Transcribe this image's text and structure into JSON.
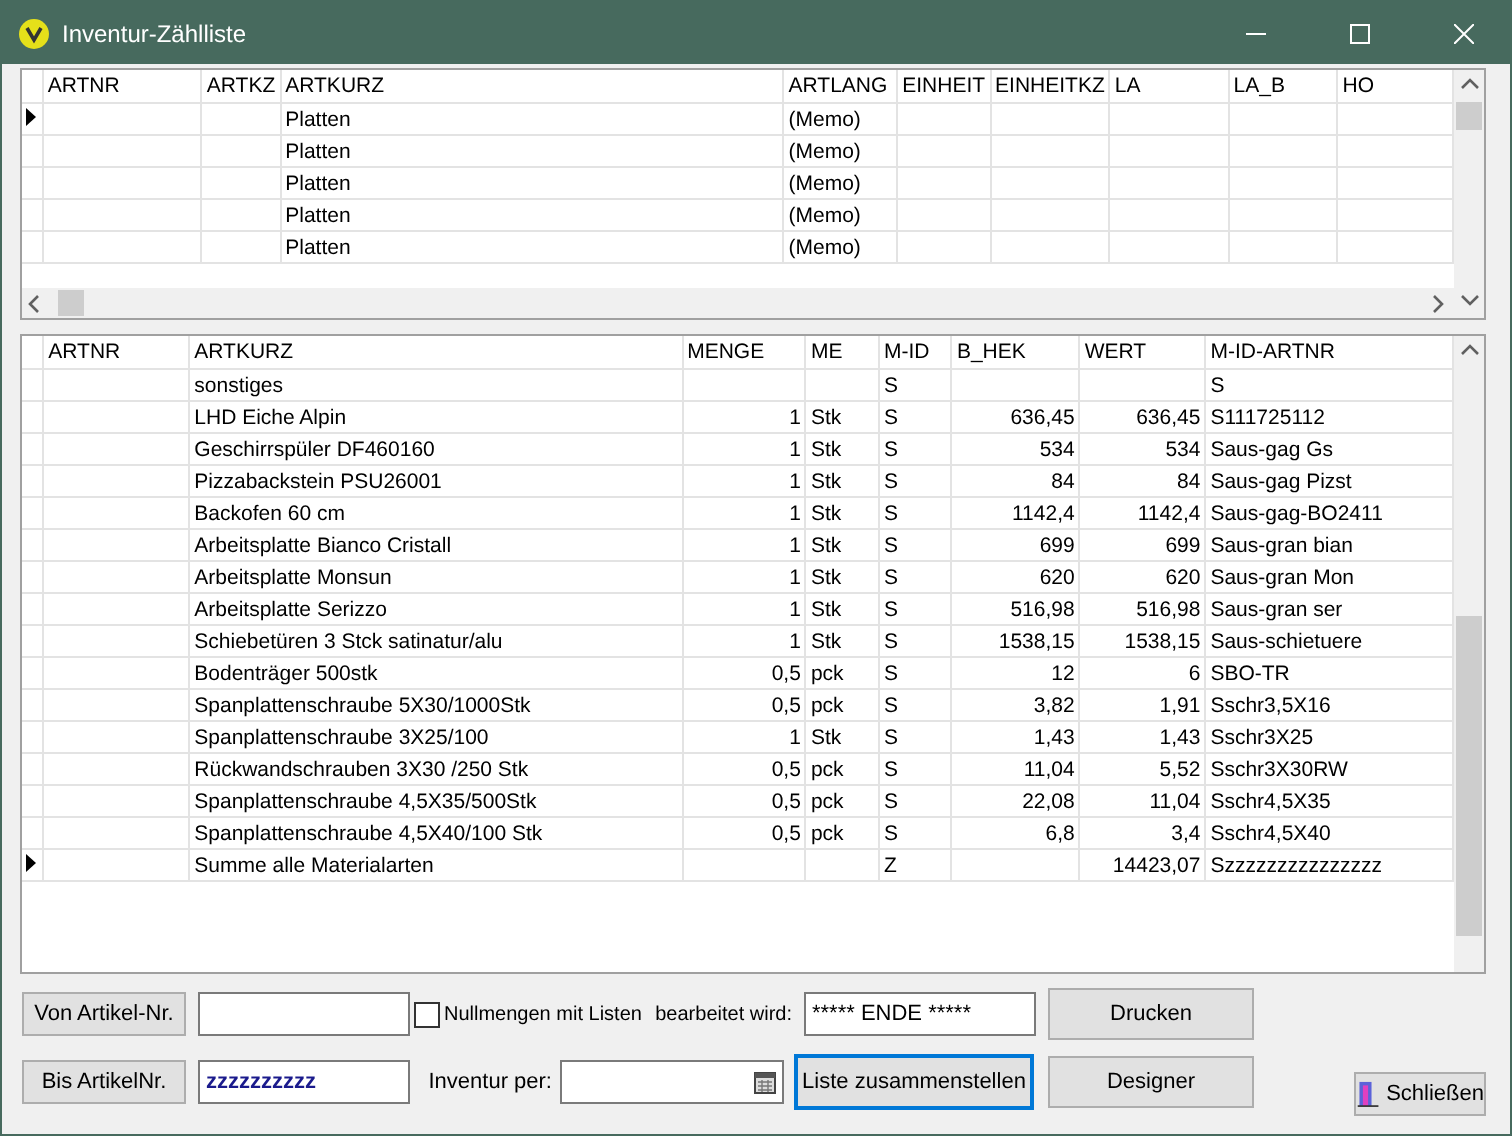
{
  "window": {
    "title": "Inventur-Zählliste"
  },
  "upper_grid": {
    "columns": [
      "ARTNR",
      "ARTKZ",
      "ARTKURZ",
      "ARTLANG",
      "EINHEIT",
      "EINHEITKZ",
      "LA",
      "LA_B",
      "HO"
    ],
    "rows": [
      {
        "current": true,
        "cells": [
          "",
          "",
          "Platten",
          "(Memo)",
          "",
          "",
          "",
          "",
          ""
        ]
      },
      {
        "current": false,
        "cells": [
          "",
          "",
          "Platten",
          "(Memo)",
          "",
          "",
          "",
          "",
          ""
        ]
      },
      {
        "current": false,
        "cells": [
          "",
          "",
          "Platten",
          "(Memo)",
          "",
          "",
          "",
          "",
          ""
        ]
      },
      {
        "current": false,
        "cells": [
          "",
          "",
          "Platten",
          "(Memo)",
          "",
          "",
          "",
          "",
          ""
        ]
      },
      {
        "current": false,
        "cells": [
          "",
          "",
          "Platten",
          "(Memo)",
          "",
          "",
          "",
          "",
          ""
        ]
      }
    ]
  },
  "lower_grid": {
    "columns": [
      "ARTNR",
      "ARTKURZ",
      "MENGE",
      "ME",
      "M-ID",
      "B_HEK",
      "WERT",
      "M-ID-ARTNR"
    ],
    "rows": [
      {
        "current": false,
        "cells": [
          "",
          "sonstiges",
          "",
          "",
          "S",
          "",
          "",
          "S"
        ]
      },
      {
        "current": false,
        "cells": [
          "",
          "LHD Eiche Alpin",
          "1",
          "Stk",
          "S",
          "636,45",
          "636,45",
          "S111725112"
        ]
      },
      {
        "current": false,
        "cells": [
          "",
          "Geschirrspüler DF460160",
          "1",
          "Stk",
          "S",
          "534",
          "534",
          "Saus-gag Gs"
        ]
      },
      {
        "current": false,
        "cells": [
          "",
          "Pizzabackstein PSU26001",
          "1",
          "Stk",
          "S",
          "84",
          "84",
          "Saus-gag Pizst"
        ]
      },
      {
        "current": false,
        "cells": [
          "",
          "Backofen 60 cm",
          "1",
          "Stk",
          "S",
          "1142,4",
          "1142,4",
          "Saus-gag-BO2411"
        ]
      },
      {
        "current": false,
        "cells": [
          "",
          "Arbeitsplatte Bianco Cristall",
          "1",
          "Stk",
          "S",
          "699",
          "699",
          "Saus-gran bian"
        ]
      },
      {
        "current": false,
        "cells": [
          "",
          "Arbeitsplatte Monsun",
          "1",
          "Stk",
          "S",
          "620",
          "620",
          "Saus-gran Mon"
        ]
      },
      {
        "current": false,
        "cells": [
          "",
          "Arbeitsplatte Serizzo",
          "1",
          "Stk",
          "S",
          "516,98",
          "516,98",
          "Saus-gran ser"
        ]
      },
      {
        "current": false,
        "cells": [
          "",
          "Schiebetüren 3 Stck satinatur/alu",
          "1",
          "Stk",
          "S",
          "1538,15",
          "1538,15",
          "Saus-schietuere"
        ]
      },
      {
        "current": false,
        "cells": [
          "",
          "Bodenträger 500stk",
          "0,5",
          "pck",
          "S",
          "12",
          "6",
          "SBO-TR"
        ]
      },
      {
        "current": false,
        "cells": [
          "",
          "Spanplattenschraube 5X30/1000Stk",
          "0,5",
          "pck",
          "S",
          "3,82",
          "1,91",
          "Sschr3,5X16"
        ]
      },
      {
        "current": false,
        "cells": [
          "",
          "Spanplattenschraube 3X25/100",
          "1",
          "Stk",
          "S",
          "1,43",
          "1,43",
          "Sschr3X25"
        ]
      },
      {
        "current": false,
        "cells": [
          "",
          "Rückwandschrauben 3X30 /250 Stk",
          "0,5",
          "pck",
          "S",
          "11,04",
          "5,52",
          "Sschr3X30RW"
        ]
      },
      {
        "current": false,
        "cells": [
          "",
          "Spanplattenschraube 4,5X35/500Stk",
          "0,5",
          "pck",
          "S",
          "22,08",
          "11,04",
          "Sschr4,5X35"
        ]
      },
      {
        "current": false,
        "cells": [
          "",
          "Spanplattenschraube 4,5X40/100 Stk",
          "0,5",
          "pck",
          "S",
          "6,8",
          "3,4",
          "Sschr4,5X40"
        ]
      },
      {
        "current": true,
        "cells": [
          "",
          "Summe alle Materialarten",
          "",
          "",
          "Z",
          "",
          "14423,07",
          "Szzzzzzzzzzzzzzz"
        ]
      }
    ]
  },
  "controls": {
    "from_button": "Von Artikel-Nr.",
    "to_button": "Bis ArtikelNr.",
    "to_value": "zzzzzzzzzz",
    "zero_quantities": {
      "label": "Nullmengen mit Listen",
      "checked": false
    },
    "processing_label": "bearbeitet wird:",
    "processing_value": "***** ENDE *****",
    "date_label": "Inventur per:",
    "compile_button": "Liste zusammenstellen",
    "print_button": "Drucken",
    "designer_button": "Designer",
    "close_button": "Schließen"
  }
}
